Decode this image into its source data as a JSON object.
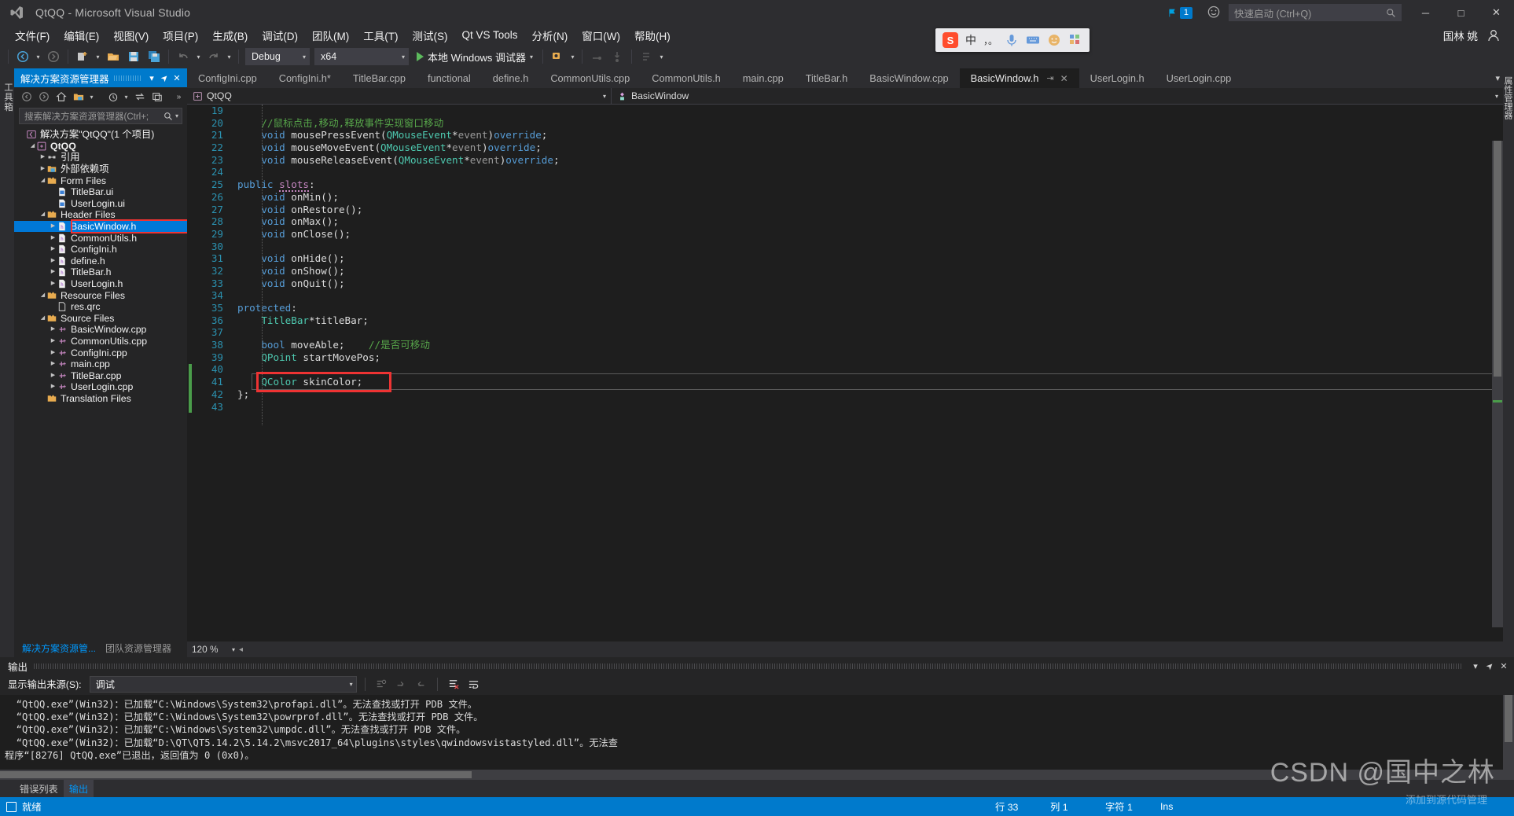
{
  "window": {
    "title": "QtQQ - Microsoft Visual Studio",
    "logo_icon": "visual-studio-logo",
    "notification_count": "1",
    "feedback_icon": "feedback-smiley-icon",
    "minimize_label": "─",
    "maximize_label": "□",
    "close_label": "✕"
  },
  "quick_launch": {
    "placeholder": "快速启动 (Ctrl+Q)",
    "icon": "search-icon"
  },
  "menu": {
    "items": [
      "文件(F)",
      "编辑(E)",
      "视图(V)",
      "项目(P)",
      "生成(B)",
      "调试(D)",
      "团队(M)",
      "工具(T)",
      "测试(S)",
      "Qt VS Tools",
      "分析(N)",
      "窗口(W)",
      "帮助(H)"
    ],
    "user": "国林 姚",
    "user_icon": "user-avatar-icon"
  },
  "toolbar": {
    "back_icon": "navigate-back-icon",
    "forward_icon": "navigate-forward-icon",
    "new_project_icon": "new-project-icon",
    "open_icon": "open-file-icon",
    "save_icon": "save-icon",
    "save_all_icon": "save-all-icon",
    "undo_icon": "undo-icon",
    "redo_icon": "redo-icon",
    "configuration": "Debug",
    "platform": "x64",
    "run_label": "本地 Windows 调试器",
    "run_icon": "play-triangle-icon",
    "attach_icon": "attach-process-icon",
    "step_icons": [
      "step-over-icon",
      "step-into-icon",
      "step-out-icon"
    ],
    "more_icon": "toolbar-overflow-icon"
  },
  "ime": {
    "brand_icon": "sogou-icon",
    "brand_letter": "S",
    "mode": "中",
    "punct": "，。",
    "mic_icon": "microphone-icon",
    "keyboard_icon": "keyboard-icon",
    "emoji_icon": "emoji-icon",
    "apps_icon": "apps-grid-icon"
  },
  "left_strip": {
    "label": "工具箱"
  },
  "right_strip": {
    "label": "属性管理器"
  },
  "solution_explorer": {
    "title": "解决方案资源管理器",
    "header_buttons": [
      {
        "name": "dropdown-chevron-icon",
        "glyph": "▾"
      },
      {
        "name": "pin-icon",
        "glyph": "➤"
      },
      {
        "name": "close-icon",
        "glyph": "✕"
      }
    ],
    "toolbar_icons": [
      "back-icon",
      "forward-icon",
      "home-icon",
      "show-all-files-icon",
      "dropdown-icon",
      "pending-changes-icon",
      "dropdown2-icon",
      "sync-icon",
      "properties-icon",
      "overflow-icon"
    ],
    "search_placeholder": "搜索解决方案资源管理器(Ctrl+;",
    "tree": [
      {
        "indent": 0,
        "arrow": "",
        "icon": "solution-icon",
        "label": "解决方案\"QtQQ\"(1 个项目)",
        "bold": false,
        "selected": false
      },
      {
        "indent": 1,
        "arrow": "open",
        "icon": "project-icon",
        "label": "QtQQ",
        "bold": true,
        "selected": false
      },
      {
        "indent": 2,
        "arrow": "closed",
        "icon": "references-icon",
        "label": "引用",
        "bold": false,
        "selected": false
      },
      {
        "indent": 2,
        "arrow": "closed",
        "icon": "external-deps-icon",
        "label": "外部依赖项",
        "bold": false,
        "selected": false
      },
      {
        "indent": 2,
        "arrow": "open",
        "icon": "folder-icon",
        "label": "Form Files",
        "bold": false,
        "selected": false
      },
      {
        "indent": 3,
        "arrow": "",
        "icon": "ui-file-icon",
        "label": "TitleBar.ui",
        "bold": false,
        "selected": false
      },
      {
        "indent": 3,
        "arrow": "",
        "icon": "ui-file-icon",
        "label": "UserLogin.ui",
        "bold": false,
        "selected": false
      },
      {
        "indent": 2,
        "arrow": "open",
        "icon": "folder-icon",
        "label": "Header Files",
        "bold": false,
        "selected": false
      },
      {
        "indent": 3,
        "arrow": "closed",
        "icon": "header-file-icon",
        "label": "BasicWindow.h",
        "bold": false,
        "selected": true
      },
      {
        "indent": 3,
        "arrow": "closed",
        "icon": "header-file-icon",
        "label": "CommonUtils.h",
        "bold": false,
        "selected": false
      },
      {
        "indent": 3,
        "arrow": "closed",
        "icon": "header-file-icon",
        "label": "ConfigIni.h",
        "bold": false,
        "selected": false
      },
      {
        "indent": 3,
        "arrow": "closed",
        "icon": "header-file-icon",
        "label": "define.h",
        "bold": false,
        "selected": false
      },
      {
        "indent": 3,
        "arrow": "closed",
        "icon": "header-file-icon",
        "label": "TitleBar.h",
        "bold": false,
        "selected": false
      },
      {
        "indent": 3,
        "arrow": "closed",
        "icon": "header-file-icon",
        "label": "UserLogin.h",
        "bold": false,
        "selected": false
      },
      {
        "indent": 2,
        "arrow": "open",
        "icon": "folder-icon",
        "label": "Resource Files",
        "bold": false,
        "selected": false
      },
      {
        "indent": 3,
        "arrow": "",
        "icon": "qrc-file-icon",
        "label": "res.qrc",
        "bold": false,
        "selected": false
      },
      {
        "indent": 2,
        "arrow": "open",
        "icon": "folder-icon",
        "label": "Source Files",
        "bold": false,
        "selected": false
      },
      {
        "indent": 3,
        "arrow": "closed",
        "icon": "cpp-file-icon",
        "label": "BasicWindow.cpp",
        "bold": false,
        "selected": false
      },
      {
        "indent": 3,
        "arrow": "closed",
        "icon": "cpp-file-icon",
        "label": "CommonUtils.cpp",
        "bold": false,
        "selected": false
      },
      {
        "indent": 3,
        "arrow": "closed",
        "icon": "cpp-file-icon",
        "label": "ConfigIni.cpp",
        "bold": false,
        "selected": false
      },
      {
        "indent": 3,
        "arrow": "closed",
        "icon": "cpp-file-icon",
        "label": "main.cpp",
        "bold": false,
        "selected": false
      },
      {
        "indent": 3,
        "arrow": "closed",
        "icon": "cpp-file-icon",
        "label": "TitleBar.cpp",
        "bold": false,
        "selected": false
      },
      {
        "indent": 3,
        "arrow": "closed",
        "icon": "cpp-file-icon",
        "label": "UserLogin.cpp",
        "bold": false,
        "selected": false
      },
      {
        "indent": 2,
        "arrow": "",
        "icon": "folder-icon",
        "label": "Translation Files",
        "bold": false,
        "selected": false
      }
    ],
    "bottom_tabs": [
      {
        "label": "解决方案资源管...",
        "active": true
      },
      {
        "label": "团队资源管理器",
        "active": false
      }
    ]
  },
  "editor": {
    "tabs": [
      {
        "label": "ConfigIni.cpp",
        "active": false
      },
      {
        "label": "ConfigIni.h*",
        "active": false
      },
      {
        "label": "TitleBar.cpp",
        "active": false
      },
      {
        "label": "functional",
        "active": false
      },
      {
        "label": "define.h",
        "active": false
      },
      {
        "label": "CommonUtils.cpp",
        "active": false
      },
      {
        "label": "CommonUtils.h",
        "active": false
      },
      {
        "label": "main.cpp",
        "active": false
      },
      {
        "label": "TitleBar.h",
        "active": false
      },
      {
        "label": "BasicWindow.cpp",
        "active": false
      },
      {
        "label": "BasicWindow.h",
        "active": true
      },
      {
        "label": "UserLogin.h",
        "active": false
      },
      {
        "label": "UserLogin.cpp",
        "active": false
      }
    ],
    "tab_pin_glyph": "⇥",
    "tab_close_glyph": "✕",
    "tab_overflow_glyph": "▾",
    "navbar": {
      "project": "QtQQ",
      "project_icon": "project-icon",
      "symbol": "BasicWindow",
      "symbol_icon": "class-icon"
    },
    "zoom": "120 %",
    "lines": [
      {
        "n": "19",
        "tokens": []
      },
      {
        "n": "20",
        "tokens": [
          {
            "t": "    ",
            "c": "pln"
          },
          {
            "t": "//鼠标点击,移动,释放事件实现窗口移动",
            "c": "cmt"
          }
        ]
      },
      {
        "n": "21",
        "tokens": [
          {
            "t": "    ",
            "c": "pln"
          },
          {
            "t": "void",
            "c": "kw"
          },
          {
            "t": " ",
            "c": "pln"
          },
          {
            "t": "mousePressEvent",
            "c": "pln"
          },
          {
            "t": "(",
            "c": "pln"
          },
          {
            "t": "QMouseEvent",
            "c": "typ"
          },
          {
            "t": "*",
            "c": "pln"
          },
          {
            "t": "event",
            "c": "par"
          },
          {
            "t": ")",
            "c": "pln"
          },
          {
            "t": "override",
            "c": "kw"
          },
          {
            "t": ";",
            "c": "pln"
          }
        ]
      },
      {
        "n": "22",
        "tokens": [
          {
            "t": "    ",
            "c": "pln"
          },
          {
            "t": "void",
            "c": "kw"
          },
          {
            "t": " ",
            "c": "pln"
          },
          {
            "t": "mouseMoveEvent",
            "c": "pln"
          },
          {
            "t": "(",
            "c": "pln"
          },
          {
            "t": "QMouseEvent",
            "c": "typ"
          },
          {
            "t": "*",
            "c": "pln"
          },
          {
            "t": "event",
            "c": "par"
          },
          {
            "t": ")",
            "c": "pln"
          },
          {
            "t": "override",
            "c": "kw"
          },
          {
            "t": ";",
            "c": "pln"
          }
        ]
      },
      {
        "n": "23",
        "tokens": [
          {
            "t": "    ",
            "c": "pln"
          },
          {
            "t": "void",
            "c": "kw"
          },
          {
            "t": " ",
            "c": "pln"
          },
          {
            "t": "mouseReleaseEvent",
            "c": "pln"
          },
          {
            "t": "(",
            "c": "pln"
          },
          {
            "t": "QMouseEvent",
            "c": "typ"
          },
          {
            "t": "*",
            "c": "pln"
          },
          {
            "t": "event",
            "c": "par"
          },
          {
            "t": ")",
            "c": "pln"
          },
          {
            "t": "override",
            "c": "kw"
          },
          {
            "t": ";",
            "c": "pln"
          }
        ]
      },
      {
        "n": "24",
        "tokens": []
      },
      {
        "n": "25",
        "tokens": [
          {
            "t": "public",
            "c": "kw"
          },
          {
            "t": " ",
            "c": "pln"
          },
          {
            "t": "slots",
            "c": "kw2 squig"
          },
          {
            "t": ":",
            "c": "pln"
          }
        ]
      },
      {
        "n": "26",
        "tokens": [
          {
            "t": "    ",
            "c": "pln"
          },
          {
            "t": "void",
            "c": "kw"
          },
          {
            "t": " ",
            "c": "pln"
          },
          {
            "t": "onMin",
            "c": "pln"
          },
          {
            "t": "();",
            "c": "pln"
          }
        ]
      },
      {
        "n": "27",
        "tokens": [
          {
            "t": "    ",
            "c": "pln"
          },
          {
            "t": "void",
            "c": "kw"
          },
          {
            "t": " ",
            "c": "pln"
          },
          {
            "t": "onRestore",
            "c": "pln"
          },
          {
            "t": "();",
            "c": "pln"
          }
        ]
      },
      {
        "n": "28",
        "tokens": [
          {
            "t": "    ",
            "c": "pln"
          },
          {
            "t": "void",
            "c": "kw"
          },
          {
            "t": " ",
            "c": "pln"
          },
          {
            "t": "onMax",
            "c": "pln"
          },
          {
            "t": "();",
            "c": "pln"
          }
        ]
      },
      {
        "n": "29",
        "tokens": [
          {
            "t": "    ",
            "c": "pln"
          },
          {
            "t": "void",
            "c": "kw"
          },
          {
            "t": " ",
            "c": "pln"
          },
          {
            "t": "onClose",
            "c": "pln"
          },
          {
            "t": "();",
            "c": "pln"
          }
        ]
      },
      {
        "n": "30",
        "tokens": []
      },
      {
        "n": "31",
        "tokens": [
          {
            "t": "    ",
            "c": "pln"
          },
          {
            "t": "void",
            "c": "kw"
          },
          {
            "t": " ",
            "c": "pln"
          },
          {
            "t": "onHide",
            "c": "pln"
          },
          {
            "t": "();",
            "c": "pln"
          }
        ]
      },
      {
        "n": "32",
        "tokens": [
          {
            "t": "    ",
            "c": "pln"
          },
          {
            "t": "void",
            "c": "kw"
          },
          {
            "t": " ",
            "c": "pln"
          },
          {
            "t": "onShow",
            "c": "pln"
          },
          {
            "t": "();",
            "c": "pln"
          }
        ]
      },
      {
        "n": "33",
        "tokens": [
          {
            "t": "    ",
            "c": "pln"
          },
          {
            "t": "void",
            "c": "kw"
          },
          {
            "t": " ",
            "c": "pln"
          },
          {
            "t": "onQuit",
            "c": "pln"
          },
          {
            "t": "();",
            "c": "pln"
          }
        ]
      },
      {
        "n": "34",
        "tokens": []
      },
      {
        "n": "35",
        "tokens": [
          {
            "t": "protected",
            "c": "kw"
          },
          {
            "t": ":",
            "c": "pln"
          }
        ]
      },
      {
        "n": "36",
        "tokens": [
          {
            "t": "    ",
            "c": "pln"
          },
          {
            "t": "TitleBar",
            "c": "typ"
          },
          {
            "t": "*titleBar;",
            "c": "pln"
          }
        ]
      },
      {
        "n": "37",
        "tokens": []
      },
      {
        "n": "38",
        "tokens": [
          {
            "t": "    ",
            "c": "pln"
          },
          {
            "t": "bool",
            "c": "kw"
          },
          {
            "t": " moveAble;    ",
            "c": "pln"
          },
          {
            "t": "//是否可移动",
            "c": "cmt"
          }
        ]
      },
      {
        "n": "39",
        "tokens": [
          {
            "t": "    ",
            "c": "pln"
          },
          {
            "t": "QPoint",
            "c": "typ"
          },
          {
            "t": " startMovePos;",
            "c": "pln"
          }
        ]
      },
      {
        "n": "40",
        "tokens": []
      },
      {
        "n": "41",
        "tokens": [
          {
            "t": "    ",
            "c": "pln"
          },
          {
            "t": "QColor",
            "c": "typ"
          },
          {
            "t": " skinColor;",
            "c": "pln"
          }
        ]
      },
      {
        "n": "42",
        "tokens": [
          {
            "t": "};",
            "c": "pln"
          }
        ]
      },
      {
        "n": "43",
        "tokens": []
      }
    ],
    "highlight_line": "41"
  },
  "output": {
    "title": "输出",
    "header_buttons": [
      {
        "name": "dropdown-chevron-icon",
        "glyph": "▾"
      },
      {
        "name": "pin-icon",
        "glyph": "➤"
      },
      {
        "name": "close-icon",
        "glyph": "✕"
      }
    ],
    "source_label": "显示输出来源(S):",
    "source_value": "调试",
    "toolbar_icons": [
      "find-message-source-icon",
      "go-to-previous-icon",
      "go-to-next-icon",
      "clear-all-icon",
      "toggle-word-wrap-icon"
    ],
    "lines": [
      "  “QtQQ.exe”(Win32)：已加载“C:\\Windows\\System32\\profapi.dll”。无法查找或打开 PDB 文件。",
      "  “QtQQ.exe”(Win32)：已加载“C:\\Windows\\System32\\powrprof.dll”。无法查找或打开 PDB 文件。",
      "  “QtQQ.exe”(Win32)：已加载“C:\\Windows\\System32\\umpdc.dll”。无法查找或打开 PDB 文件。",
      "  “QtQQ.exe”(Win32)：已加载“D:\\QT\\QT5.14.2\\5.14.2\\msvc2017_64\\plugins\\styles\\qwindowsvistastyled.dll”。无法查",
      "程序“[8276] QtQQ.exe”已退出，返回值为 0 (0x0)。"
    ]
  },
  "bottom_tabs": [
    {
      "label": "错误列表",
      "active": false
    },
    {
      "label": "输出",
      "active": true
    }
  ],
  "status_bar": {
    "icon": "ready-icon",
    "message": "就绪",
    "line": "行 33",
    "column": "列 1",
    "char": "字符 1",
    "insert_mode": "Ins"
  },
  "watermark": {
    "main": "CSDN @国中之林",
    "sub": "添加到源代码管理"
  },
  "colors": {
    "accent": "#007acc",
    "chrome": "#2d2d30",
    "panel": "#252526",
    "editor_bg": "#1e1e1e",
    "selection": "#0078d7",
    "highlight_red": "#ee3333",
    "comment_green": "#57a64a"
  }
}
